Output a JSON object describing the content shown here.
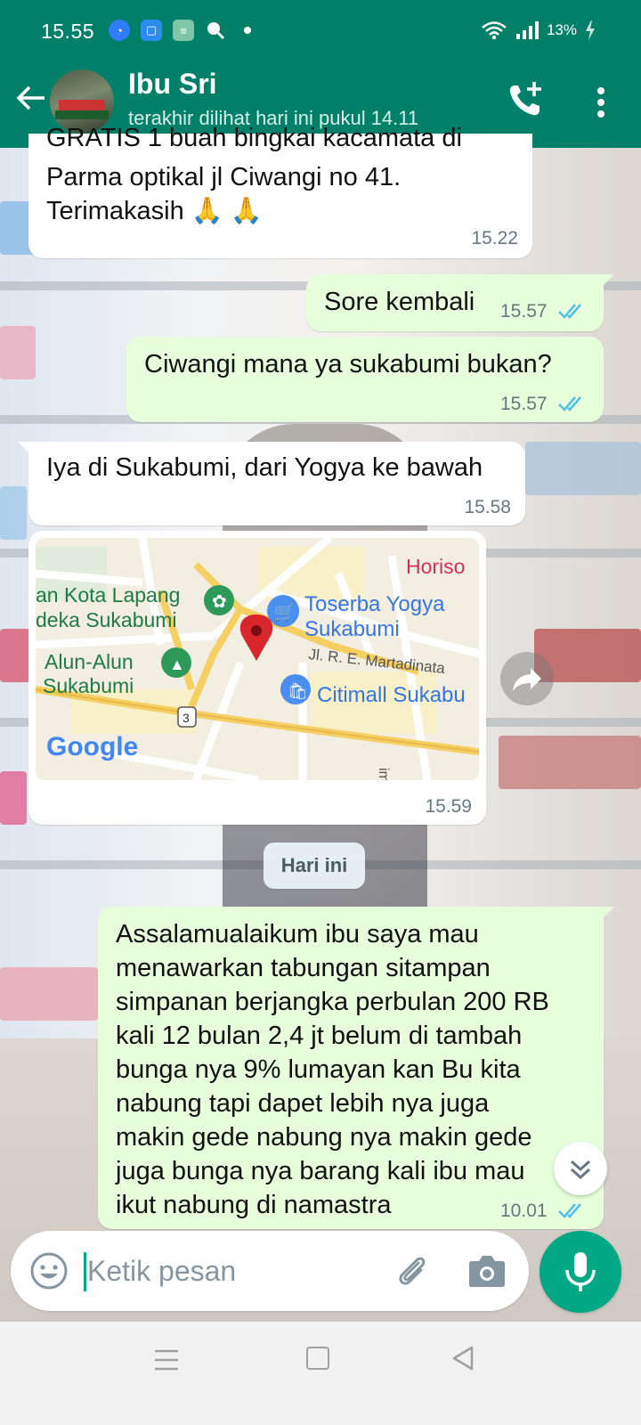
{
  "status_bar": {
    "time": "15.55",
    "battery": "13%",
    "icons": [
      "browser-icon",
      "app-icon",
      "notes-icon",
      "search-icon",
      "dot-icon",
      "wifi-icon",
      "signal-icon",
      "battery-icon"
    ]
  },
  "header": {
    "contact_name": "Ibu Sri",
    "contact_status": "terakhir dilihat hari ini pukul 14.11"
  },
  "messages": [
    {
      "direction": "incoming",
      "text_partial_top": "GRATIS  1 buah bingkai kacamata  di",
      "text": "Parma optikal jl Ciwangi no 41.\nTerimakasih 🙏 🙏",
      "time": "15.22"
    },
    {
      "direction": "outgoing",
      "text": "Sore kembali",
      "time": "15.57",
      "status": "read"
    },
    {
      "direction": "outgoing",
      "text": "Ciwangi mana ya sukabumi bukan?",
      "time": "15.57",
      "status": "read"
    },
    {
      "direction": "incoming",
      "text": "Iya di Sukabumi, dari Yogya ke bawah",
      "time": "15.58"
    },
    {
      "direction": "incoming",
      "type": "location",
      "time": "15.59",
      "map_labels": {
        "horiso": "Horiso",
        "kota_lapang_1": "an Kota Lapang",
        "kota_lapang_2": "deka Sukabumi",
        "toserba_1": "Toserba Yogya",
        "toserba_2": "Sukabumi",
        "street": "Jl. R. E. Martadinata",
        "alun_1": "Alun-Alun",
        "alun_2": "Sukabumi",
        "route": "3",
        "citimall": "Citimall Sukabu",
        "brand": "Google",
        "vertical": "im."
      }
    },
    {
      "direction": "divider",
      "text": "Hari ini"
    },
    {
      "direction": "outgoing",
      "text": "Assalamualaikum ibu saya mau\nmenawarkan tabungan sitampan\nsimpanan berjangka perbulan 200 RB\nkali 12 bulan 2,4 jt belum di tambah\nbunga nya 9% lumayan kan Bu kita\nnabung tapi dapet lebih nya juga\nmakin gede nabung nya makin gede\njuga bunga nya barang kali ibu mau\nikut nabung di namastra",
      "time": "10.01",
      "status": "read"
    }
  ],
  "input": {
    "placeholder": "Ketik pesan"
  },
  "colors": {
    "header": "#008069",
    "accent": "#00a884",
    "outgoing_bubble": "#e7ffdb",
    "incoming_bubble": "#ffffff",
    "read_ticks": "#53bdeb"
  }
}
